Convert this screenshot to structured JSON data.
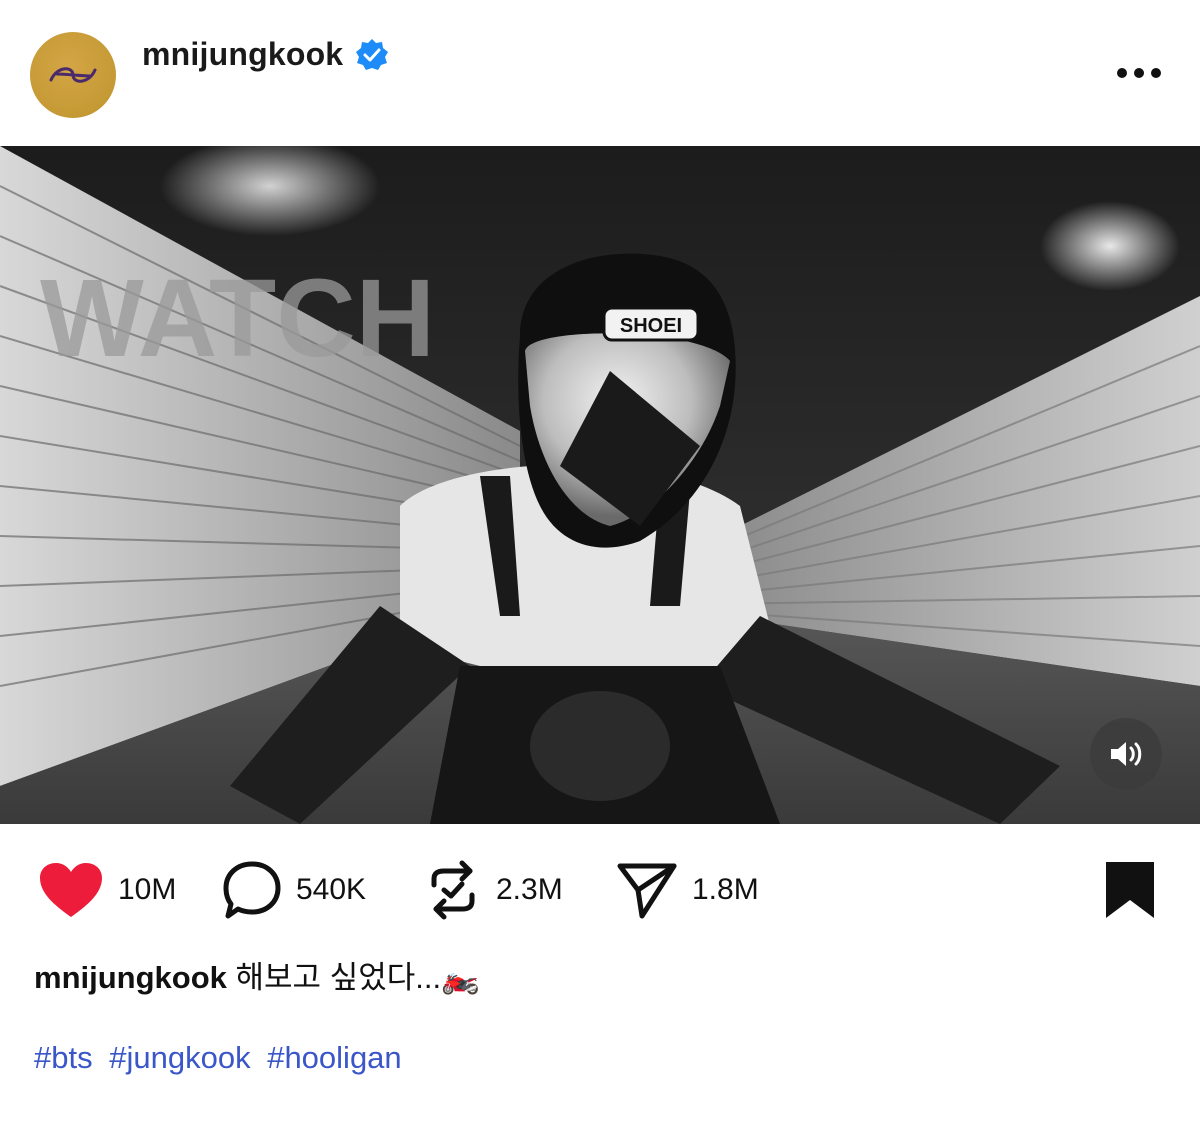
{
  "post": {
    "username": "mnijungkook",
    "avatar_icon": "gold-logo-avatar",
    "verified_icon": "verified-badge-icon",
    "accent_verified_color": "#1d8cf8"
  },
  "media": {
    "type": "video",
    "sign_text": "WATCH",
    "helmet_text": "SHOEI",
    "sound_icon": "speaker-on-icon"
  },
  "actions": {
    "likes": "10M",
    "comments": "540K",
    "reposts": "2.3M",
    "shares": "1.8M",
    "like_color": "#ed1c3a"
  },
  "caption": {
    "username": "mnijungkook",
    "text": "해보고 싶었다...🏍️"
  },
  "hashtags": [
    "#bts",
    "#jungkook",
    "#hooligan"
  ]
}
